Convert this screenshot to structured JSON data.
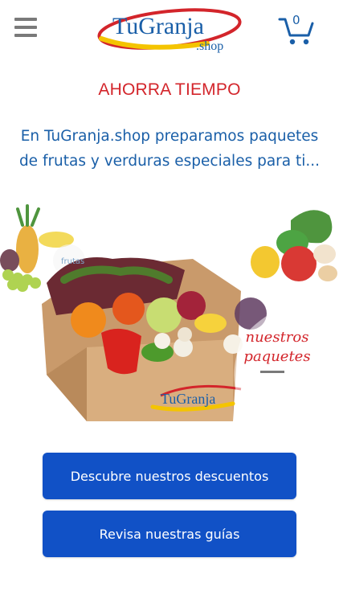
{
  "header": {
    "logo_main": "TuGranja",
    "logo_sub": ".shop",
    "cart_count": "0"
  },
  "headline": "AHORRA TIEMPO",
  "intro": "En TuGranja.shop preparamos paquetes de frutas y verduras especiales para ti...",
  "hero": {
    "label_frutas": "frutas",
    "label_paquetes_line1": "nuestros",
    "label_paquetes_line2": "paquetes",
    "box_brand": "TuGranja"
  },
  "buttons": {
    "discounts": "Descubre nuestros descuentos",
    "guides": "Revisa nuestras guías"
  },
  "colors": {
    "brand_blue": "#1a5fa8",
    "button_blue": "#1151c6",
    "accent_red": "#d3252b",
    "logo_yellow": "#f4c400"
  }
}
